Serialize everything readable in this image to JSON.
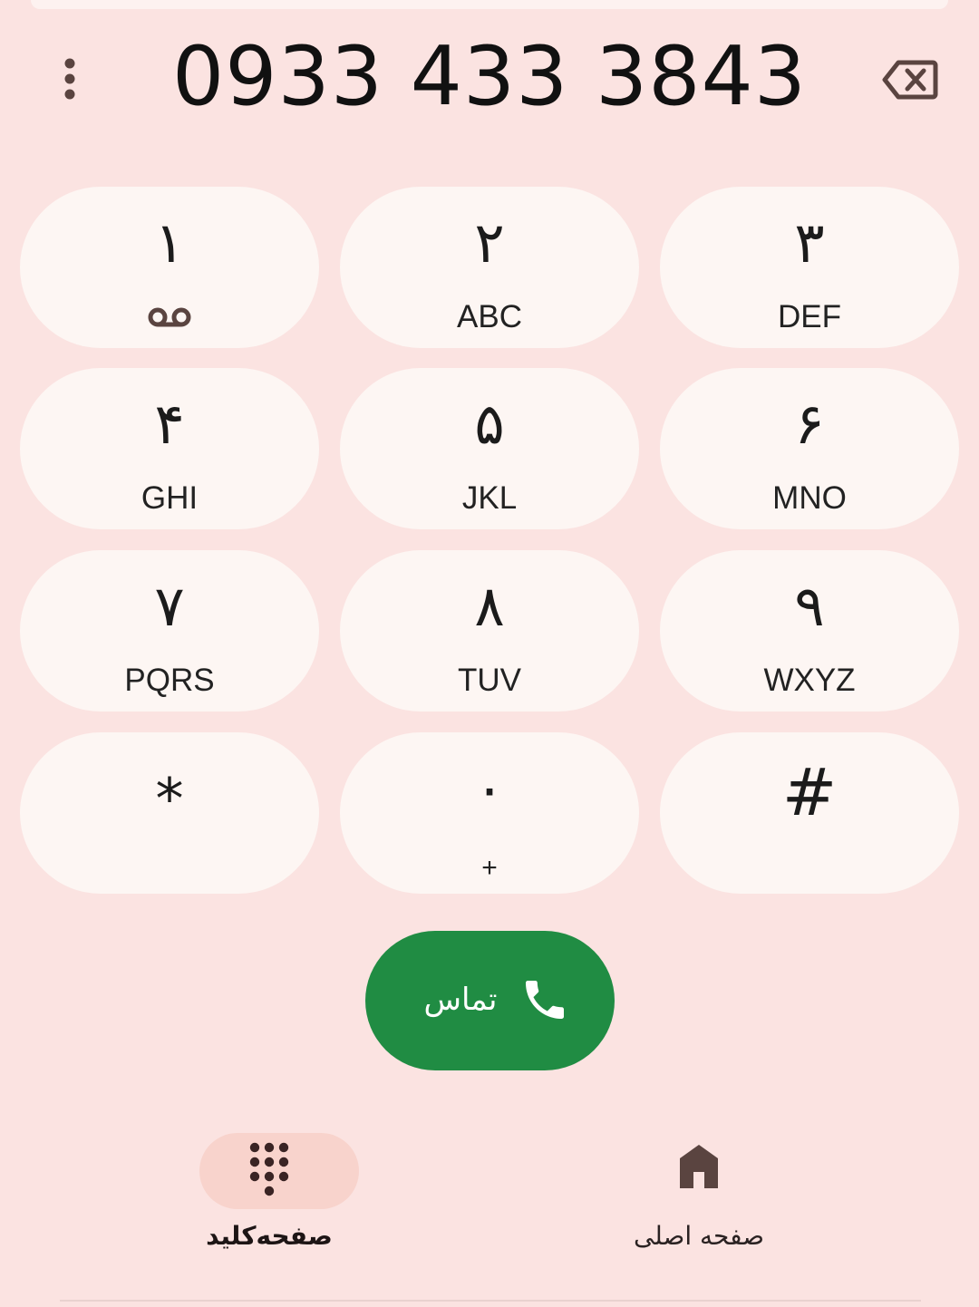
{
  "dialer": {
    "number": "0933 433 3843"
  },
  "keys": [
    {
      "digit": "۱",
      "sub": ""
    },
    {
      "digit": "۲",
      "sub": "ABC"
    },
    {
      "digit": "۳",
      "sub": "DEF"
    },
    {
      "digit": "۴",
      "sub": "GHI"
    },
    {
      "digit": "۵",
      "sub": "JKL"
    },
    {
      "digit": "۶",
      "sub": "MNO"
    },
    {
      "digit": "۷",
      "sub": "PQRS"
    },
    {
      "digit": "۸",
      "sub": "TUV"
    },
    {
      "digit": "۹",
      "sub": "WXYZ"
    },
    {
      "digit": "*",
      "sub": ""
    },
    {
      "digit": "۰",
      "sub": "+"
    },
    {
      "digit": "#",
      "sub": ""
    }
  ],
  "call_button": {
    "label": "تماس"
  },
  "bottom_nav": {
    "keypad_label": "صفحه‌کلید",
    "home_label": "صفحه اصلی"
  },
  "colors": {
    "background": "#fbe3e1",
    "key_bg": "#fdf6f3",
    "call_green": "#208c43",
    "active_pill": "#f8d3cc",
    "icon_brown": "#5a4440"
  },
  "icons": {
    "menu": "more-vert-icon",
    "backspace": "backspace-icon",
    "voicemail": "voicemail-icon",
    "call": "phone-icon",
    "keypad": "dialpad-icon",
    "home": "home-icon"
  }
}
